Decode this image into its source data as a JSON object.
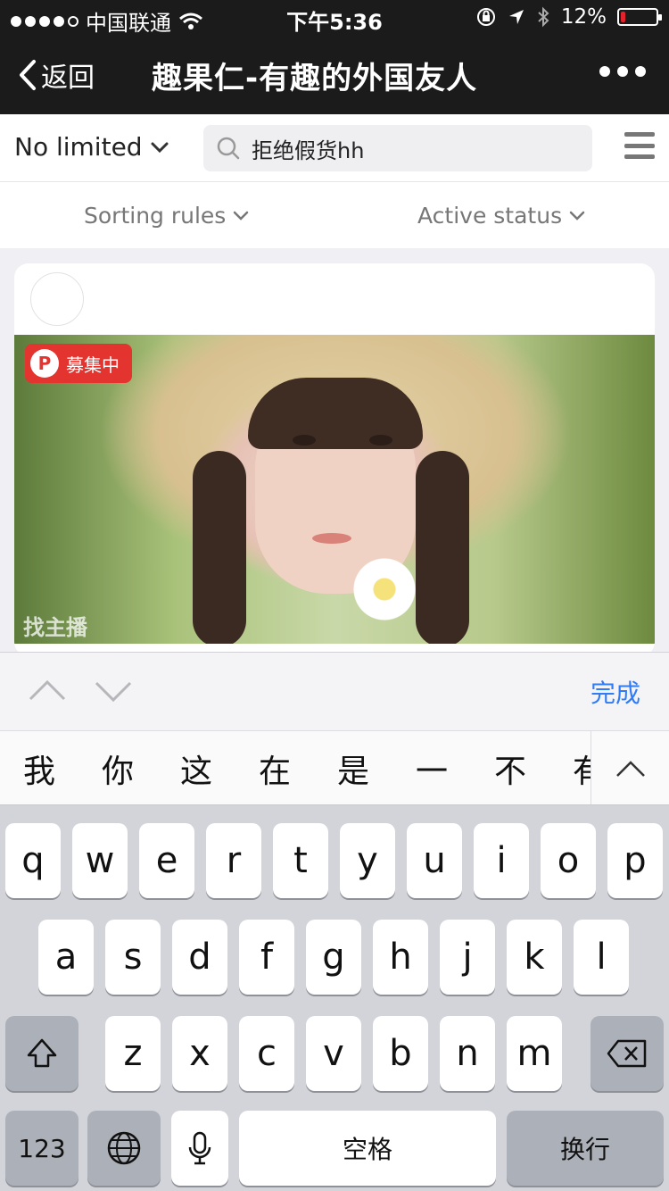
{
  "status_bar": {
    "carrier": "中国联通",
    "time": "下午5:36",
    "battery_pct": "12%",
    "battery_level": 0.12,
    "signal_bars": 4,
    "icons": [
      "wifi-icon",
      "rotation-lock-icon",
      "location-icon",
      "bluetooth-icon",
      "battery-icon"
    ]
  },
  "nav": {
    "back_label": "返回",
    "title": "趣果仁-有趣的外国友人",
    "more_icon": "more-dots-icon"
  },
  "filter": {
    "region_label": "No limited",
    "search_value": "拒绝假货hh",
    "search_icon": "search-icon",
    "menu_icon": "hamburger-menu-icon"
  },
  "sort": {
    "sorting_label": "Sorting rules",
    "active_label": "Active status"
  },
  "card": {
    "badge_label": "募集中",
    "watermark": "找主播"
  },
  "accessory": {
    "done_label": "完成"
  },
  "candidates": [
    "我",
    "你",
    "这",
    "在",
    "是",
    "一",
    "不",
    "有"
  ],
  "keyboard": {
    "row1": [
      "q",
      "w",
      "e",
      "r",
      "t",
      "y",
      "u",
      "i",
      "o",
      "p"
    ],
    "row2": [
      "a",
      "s",
      "d",
      "f",
      "g",
      "h",
      "j",
      "k",
      "l"
    ],
    "row3": [
      "z",
      "x",
      "c",
      "v",
      "b",
      "n",
      "m"
    ],
    "numbers_label": "123",
    "space_label": "空格",
    "return_label": "换行"
  },
  "colors": {
    "nav_bg": "#1b1b1b",
    "accent_blue": "#2f7cf6",
    "badge_red": "#e3342f",
    "page_bg": "#efeff4",
    "keyboard_bg": "#d2d4da"
  }
}
